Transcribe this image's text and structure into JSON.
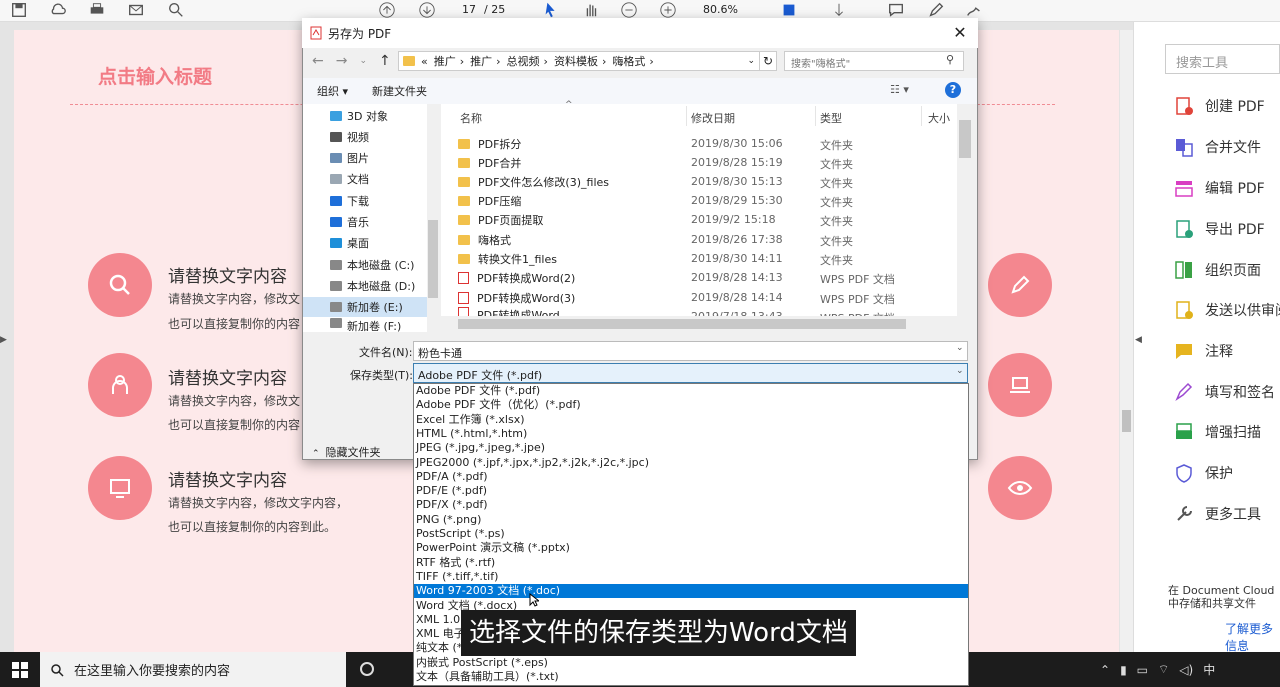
{
  "toolbar": {
    "page_current": "17",
    "page_total": "/ 25",
    "zoom": "80.6%"
  },
  "page": {
    "title": "点击输入标题",
    "sections": [
      {
        "title": "请替换文字内容",
        "line1": "请替换文字内容，修改文",
        "line2": "也可以直接复制你的内容"
      },
      {
        "title": "请替换文字内容",
        "line1": "请替换文字内容，修改文",
        "line2": "也可以直接复制你的内容"
      },
      {
        "title": "请替换文字内容",
        "line1": "请替换文字内容，修改文字内容，",
        "line2": "也可以直接复制你的内容到此。"
      }
    ]
  },
  "right_panel": {
    "search_placeholder": "搜索工具",
    "items": [
      "创建 PDF",
      "合并文件",
      "编辑 PDF",
      "导出 PDF",
      "组织页面",
      "发送以供审阅",
      "注释",
      "填写和签名",
      "增强扫描",
      "保护",
      "更多工具"
    ],
    "bottom_text": "在 Document Cloud 中存储和共享文件",
    "bottom_link": "了解更多信息"
  },
  "dialog": {
    "title": "另存为 PDF",
    "path": [
      "«",
      "推广",
      "推广",
      "总视频",
      "资料模板",
      "嗨格式"
    ],
    "search_placeholder": "搜索\"嗨格式\"",
    "organize": "组织 ▾",
    "new_folder": "新建文件夹",
    "nav": [
      "3D 对象",
      "视频",
      "图片",
      "文档",
      "下载",
      "音乐",
      "桌面",
      "本地磁盘 (C:)",
      "本地磁盘 (D:)",
      "新加卷 (E:)",
      "新加卷 (F:)"
    ],
    "columns": [
      "名称",
      "修改日期",
      "类型",
      "大小"
    ],
    "files": [
      {
        "name": "PDF拆分",
        "date": "2019/8/30 15:06",
        "type": "文件夹",
        "kind": "folder"
      },
      {
        "name": "PDF合并",
        "date": "2019/8/28 15:19",
        "type": "文件夹",
        "kind": "folder"
      },
      {
        "name": "PDF文件怎么修改(3)_files",
        "date": "2019/8/30 15:13",
        "type": "文件夹",
        "kind": "folder"
      },
      {
        "name": "PDF压缩",
        "date": "2019/8/29 15:30",
        "type": "文件夹",
        "kind": "folder"
      },
      {
        "name": "PDF页面提取",
        "date": "2019/9/2 15:18",
        "type": "文件夹",
        "kind": "folder"
      },
      {
        "name": "嗨格式",
        "date": "2019/8/26 17:38",
        "type": "文件夹",
        "kind": "folder"
      },
      {
        "name": "转换文件1_files",
        "date": "2019/8/30 14:11",
        "type": "文件夹",
        "kind": "folder"
      },
      {
        "name": "PDF转换成Word(2)",
        "date": "2019/8/28 14:13",
        "type": "WPS PDF 文档",
        "kind": "pdf"
      },
      {
        "name": "PDF转换成Word(3)",
        "date": "2019/8/28 14:14",
        "type": "WPS PDF 文档",
        "kind": "pdf"
      },
      {
        "name": "PDF转换成Word",
        "date": "2019/7/18 13:43",
        "type": "WPS PDF 文档",
        "kind": "pdf"
      }
    ],
    "filename_label": "文件名(N):",
    "filename_value": "粉色卡通",
    "filetype_label": "保存类型(T):",
    "filetype_value": "Adobe PDF 文件 (*.pdf)",
    "hide_folders": "隐藏文件夹",
    "type_options": [
      "Adobe PDF 文件 (*.pdf)",
      "Adobe PDF 文件（优化）(*.pdf)",
      "Excel 工作簿 (*.xlsx)",
      "HTML (*.html,*.htm)",
      "JPEG (*.jpg,*.jpeg,*.jpe)",
      "JPEG2000 (*.jpf,*.jpx,*.jp2,*.j2k,*.j2c,*.jpc)",
      "PDF/A (*.pdf)",
      "PDF/E (*.pdf)",
      "PDF/X (*.pdf)",
      "PNG (*.png)",
      "PostScript (*.ps)",
      "PowerPoint 演示文稿 (*.pptx)",
      "RTF 格式 (*.rtf)",
      "TIFF (*.tiff,*.tif)",
      "Word 97-2003 文档 (*.doc)",
      "Word 文档 (*.docx)",
      "XML 1.0 (*.xml)",
      "XML 电子表格 2003 (*.xml)",
      "纯文本 (*.txt)",
      "内嵌式 PostScript (*.eps)",
      "文本（具备辅助工具）(*.txt)"
    ],
    "selected_option_index": 14
  },
  "subtitle": "选择文件的保存类型为Word文档",
  "taskbar": {
    "search_placeholder": "在这里输入你要搜索的内容",
    "ime": "中"
  }
}
